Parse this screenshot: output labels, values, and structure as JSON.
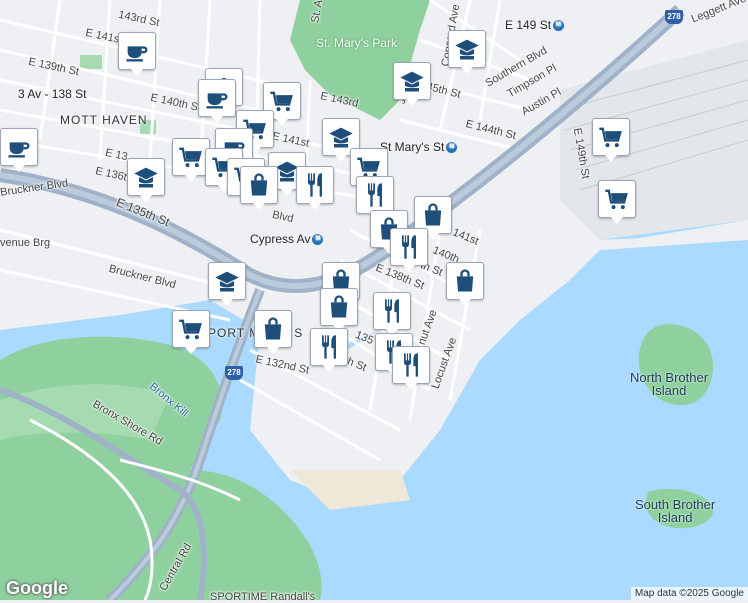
{
  "colors": {
    "water": "#aadaff",
    "park": "#8fd19e",
    "land": "#eef0f3",
    "street": "#ffffff",
    "highway": "#9fb2c8",
    "icon": "#1e4f7a"
  },
  "labels": {
    "st_marys_park": "St. Mary's Park",
    "mott_haven": "MOTT HAVEN",
    "port_morris": "PORT MORRIS",
    "north_brother_1": "North Brother",
    "north_brother_2": "Island",
    "south_brother_1": "South Brother",
    "south_brother_2": "Island",
    "bronx_kill": "Bronx Kill",
    "bronx_shore_rd": "Bronx Shore Rd",
    "central_rd": "Central Rd",
    "sportime": "SPORTIME Randall's"
  },
  "stations": {
    "ave_138": "3 Av - 138 St",
    "cypress_av": "Cypress Av",
    "e_149": "E 149 St",
    "st_marys_st": "St Mary's St"
  },
  "streets": {
    "e143_top": "143rd St",
    "e141_left": "E 141st St",
    "e139": "E 139th St",
    "e140": "E 140th St",
    "e143": "E 143rd",
    "e141": "E 141st",
    "e13x": "E 13",
    "e136": "E 136th",
    "e135": "E 135th St",
    "bruckner": "Bruckner Blvd",
    "bruckner2": "Bruckner Blvd",
    "avenue_brg": "venue Brg",
    "blvd": "Blvd",
    "blvd2": "Blvd",
    "e132": "E 132nd St",
    "e138": "E 138th St",
    "th_st": "th St",
    "e140_r": "140th",
    "e141_r": "141st",
    "e144": "E 144th St",
    "e145": "145th St",
    "southern": "Southern Blvd",
    "timpson": "Timpson Pl",
    "austin": "Austin Pl",
    "leggett": "Leggett Ave",
    "e149_st": "E 149th St",
    "concord": "Concord Ave",
    "jackson": "Jac",
    "locust": "Locust Ave",
    "nut": "nut Ave",
    "st_a": "St. A",
    "th_st_135": "135",
    "s_13": "13",
    "th_st_134": "4th St",
    "e148": "E"
  },
  "highway_shield": "278",
  "highway_shield_2": "278",
  "pins": [
    {
      "id": "cafe-1",
      "type": "cafe-icon"
    },
    {
      "id": "school-1",
      "type": "school-icon"
    },
    {
      "id": "cafe-2",
      "type": "cafe-icon"
    },
    {
      "id": "grocery-1",
      "type": "grocery-icon"
    },
    {
      "id": "school-2",
      "type": "school-icon"
    },
    {
      "id": "school-3",
      "type": "school-icon"
    },
    {
      "id": "cafe-3",
      "type": "cafe-icon"
    },
    {
      "id": "grocery-2",
      "type": "grocery-icon"
    }
  ],
  "google": "Google",
  "attribution": "Map data ©2025 Google"
}
